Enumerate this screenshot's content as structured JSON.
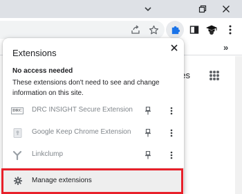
{
  "colors": {
    "titlebar": "#dee1e6",
    "accent": "#1a73e8",
    "highlight": "#e8202a"
  },
  "browser": {
    "bookmarks_more": "»",
    "partial_page_text": "ges"
  },
  "extensions_popup": {
    "title": "Extensions",
    "section_heading": "No access needed",
    "section_description": "These extensions don't need to see and change information on this site.",
    "extensions": [
      {
        "name": "DRC INSIGHT Secure Extension",
        "logo_text": "DRC",
        "pinned": false
      },
      {
        "name": "Google Keep Chrome Extension",
        "logo_text": "",
        "pinned": false
      },
      {
        "name": "Linkclump",
        "logo_text": "",
        "pinned": false
      }
    ],
    "manage_label": "Manage extensions"
  }
}
